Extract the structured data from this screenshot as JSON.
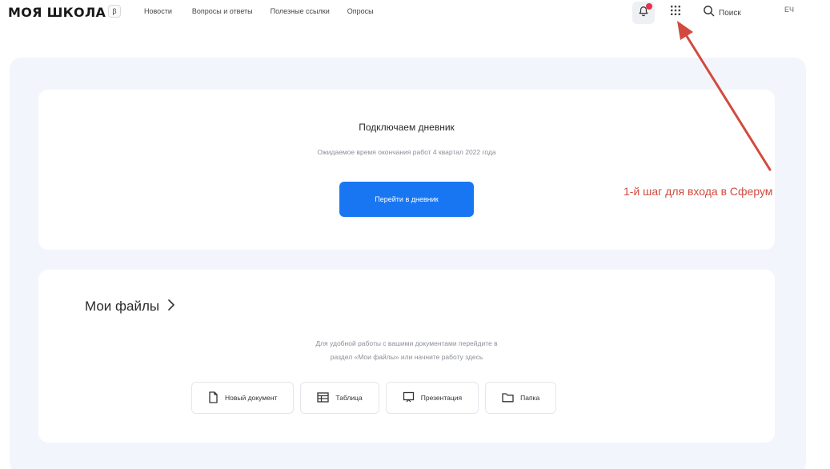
{
  "header": {
    "logo": "МОЯ ШКОЛА",
    "beta": "β",
    "nav": [
      "Новости",
      "Вопросы и ответы",
      "Полезные ссылки",
      "Опросы"
    ],
    "search_label": "Поиск",
    "avatar": "ЕЧ",
    "icons": {
      "notifications": "bell-icon",
      "apps": "grid-icon",
      "search": "search-icon"
    }
  },
  "diary": {
    "title": "Подключаем дневник",
    "subtitle": "Ожидаемое время окончания работ 4 квартал 2022 года",
    "button": "Перейти в дневник"
  },
  "files": {
    "title": "Мои файлы",
    "description_line1": "Для удобной работы с вашими документами перейдите в",
    "description_line2": "раздел «Мои файлы» или начните работу здесь",
    "actions": [
      {
        "label": "Новый документ",
        "icon": "document-icon"
      },
      {
        "label": "Таблица",
        "icon": "table-icon"
      },
      {
        "label": "Презентация",
        "icon": "presentation-icon"
      },
      {
        "label": "Папка",
        "icon": "folder-icon"
      }
    ]
  },
  "annotation": {
    "text": "1-й шаг для входа в Сферум"
  },
  "colors": {
    "accent": "#1976f2",
    "background": "#f2f5fb",
    "annotation": "#d24a3e",
    "badge": "#e6324b"
  }
}
